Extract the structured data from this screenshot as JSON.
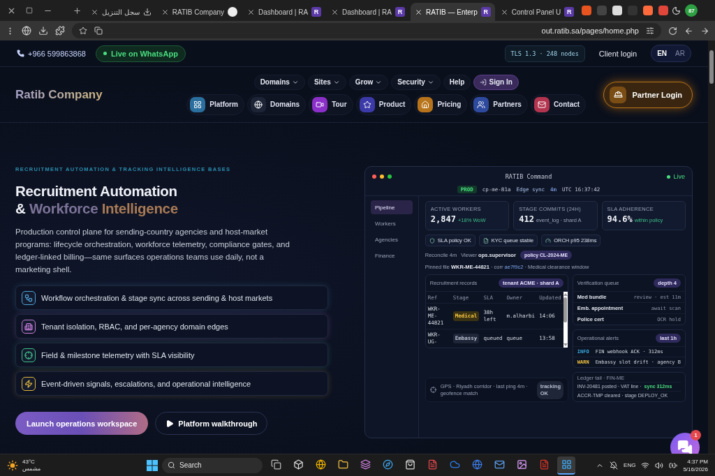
{
  "browser": {
    "tabs": [
      {
        "kind": "download",
        "title": "سجل التنزيل",
        "selected": false
      },
      {
        "kind": "app",
        "title": "RATIB Company",
        "selected": false
      },
      {
        "kind": "letter",
        "title": "Dashboard | RA",
        "favicon": "R",
        "selected": false
      },
      {
        "kind": "letter",
        "title": "Dashboard | RA",
        "favicon": "R",
        "selected": false
      },
      {
        "kind": "letter",
        "title": "RATIB — Enterp",
        "favicon": "R",
        "selected": true
      },
      {
        "kind": "letter",
        "title": "Control Panel U",
        "favicon": "R",
        "selected": false
      }
    ],
    "profile_badge": "87",
    "url": "out.ratib.sa/pages/home.php"
  },
  "topbar": {
    "phone": "+966 599863868",
    "whatsapp": "Live on WhatsApp",
    "tls": "TLS 1.3 · 248 nodes",
    "client_login": "Client login",
    "languages": [
      {
        "label": "EN",
        "selected": true
      },
      {
        "label": "AR",
        "selected": false
      }
    ]
  },
  "header": {
    "logo": "Ratib Company",
    "menu": [
      {
        "label": "Domains",
        "kind": "dropdown"
      },
      {
        "label": "Sites",
        "kind": "dropdown"
      },
      {
        "label": "Grow",
        "kind": "dropdown"
      },
      {
        "label": "Security",
        "kind": "dropdown"
      },
      {
        "label": "Help",
        "kind": "link"
      },
      {
        "label": "Sign In",
        "kind": "cta"
      }
    ],
    "nav": [
      {
        "label": "Platform",
        "color": "#2a6f9e"
      },
      {
        "label": "Domains",
        "color": "#1c2436"
      },
      {
        "label": "Tour",
        "color": "#8b2fc9"
      },
      {
        "label": "Product",
        "color": "#3b3aa8"
      },
      {
        "label": "Pricing",
        "color": "#b8741a"
      },
      {
        "label": "Partners",
        "color": "#2e4a9e"
      },
      {
        "label": "Contact",
        "color": "#b3344f"
      }
    ],
    "partner_login": "Partner Login"
  },
  "hero": {
    "eyebrow": "RECRUITMENT AUTOMATION & TRACKING INTELLIGENCE BASES",
    "title_line1": "Recruitment Automation",
    "title_prefix": "&",
    "title_accent_1": "Workforce",
    "title_accent_2": "Intelligence",
    "description": "Production control plane for sending-country agencies and host-market programs: lifecycle orchestration, workforce telemetry, compliance gates, and ledger-linked billing—same surfaces operations teams use daily, not a marketing shell.",
    "features": [
      {
        "color": "#4fa3d9",
        "text": "Workflow orchestration & stage sync across sending & host markets"
      },
      {
        "color": "#c77ddb",
        "text": "Tenant isolation, RBAC, and per-agency domain edges"
      },
      {
        "color": "#3fbf8a",
        "text": "Field & milestone telemetry with SLA visibility"
      },
      {
        "color": "#e0b53a",
        "text": "Event-driven signals, escalations, and operational intelligence"
      }
    ],
    "primary_button": "Launch operations workspace",
    "secondary_button": "Platform walkthrough"
  },
  "console": {
    "title": "RATIB Command",
    "status": "Live",
    "env": "PROD",
    "cluster": "cp-me-81a",
    "sync_label": "Edge sync",
    "sync_value": "4m",
    "clock": "UTC 16:37:42",
    "sidebar": [
      {
        "label": "Pipeline",
        "selected": true
      },
      {
        "label": "Workers",
        "selected": false
      },
      {
        "label": "Agencies",
        "selected": false
      },
      {
        "label": "Finance",
        "selected": false
      }
    ],
    "kpis": [
      {
        "label": "ACTIVE WORKERS",
        "value": "2,847",
        "note": "+18% WoW",
        "kind": "good"
      },
      {
        "label": "STAGE COMMITS (24H)",
        "value": "412",
        "note": "event_log · shard A",
        "kind": "neutral"
      },
      {
        "label": "SLA ADHERENCE",
        "value": "94.6%",
        "note": "within policy",
        "kind": "good"
      }
    ],
    "chips": [
      "SLA policy OK",
      "KYC queue stable",
      "ORCH p95 238ms"
    ],
    "reconcile": "Reconcile 4m",
    "viewer": "Viewer **ops.supervisor**",
    "policy": "policy CL-2024-ME",
    "pinned": {
      "label": "Pinned file",
      "file": "WKR-ME-44821",
      "corr_label": "· corr",
      "corr": "ae7f9c2",
      "note": "· Medical clearance window"
    },
    "records": {
      "title": "Recruitment records",
      "badge": "tenant ACME · shard A",
      "columns": [
        "Ref",
        "Stage",
        "SLA",
        "Owner",
        "Updated"
      ],
      "rows": [
        {
          "ref": "WKR-ME-44821",
          "stage": "Medical",
          "kind": "medical",
          "sla": "38h left",
          "owner": "m.alharbi",
          "updated": "14:06"
        },
        {
          "ref": "WKR-UG-",
          "stage": "Embassy",
          "kind": "embassy",
          "sla": "queued",
          "owner": "queue",
          "updated": "13:58"
        }
      ]
    },
    "verification": {
      "title": "Verification queue",
      "badge": "depth 4",
      "items": [
        {
          "label": "Med bundle",
          "status": "review · est 11m"
        },
        {
          "label": "Emb. appointment",
          "status": "await scan"
        },
        {
          "label": "Police cert",
          "status": "OCR hold"
        }
      ]
    },
    "alerts": {
      "title": "Operational alerts",
      "badge": "last 1h",
      "items": [
        {
          "level": "INFO",
          "kind": "info",
          "text": "FIN webhook ACK · 312ms"
        },
        {
          "level": "WARN",
          "kind": "warn",
          "text": "Embassy slot drift · agency B"
        }
      ]
    },
    "gps": {
      "text": "GPS · Riyadh corridor · last ping 4m · geofence match",
      "badge": "tracking OK"
    },
    "ledger": {
      "title": "Ledger tail · FIN-ME",
      "lines": [
        {
          "text": "INV-20481 posted · VAT line ·",
          "highlight": "sync 312ms"
        },
        {
          "text": "ACCR-TMP cleared · stage DEPLOY_OK"
        }
      ]
    }
  },
  "chat": {
    "badge": "1"
  },
  "taskbar": {
    "temperature": "43°C",
    "weather": "مشمس",
    "search": "Search",
    "language": "ENG",
    "time": "4:37 PM",
    "date": "5/16/2026",
    "apps": [
      {
        "selected": false
      },
      {
        "selected": false
      },
      {
        "selected": false
      },
      {
        "selected": false
      },
      {
        "selected": false
      },
      {
        "selected": false
      },
      {
        "selected": false
      },
      {
        "selected": false
      },
      {
        "selected": false
      },
      {
        "selected": false
      },
      {
        "selected": false
      },
      {
        "selected": false
      },
      {
        "selected": false
      },
      {
        "selected": true
      }
    ]
  }
}
